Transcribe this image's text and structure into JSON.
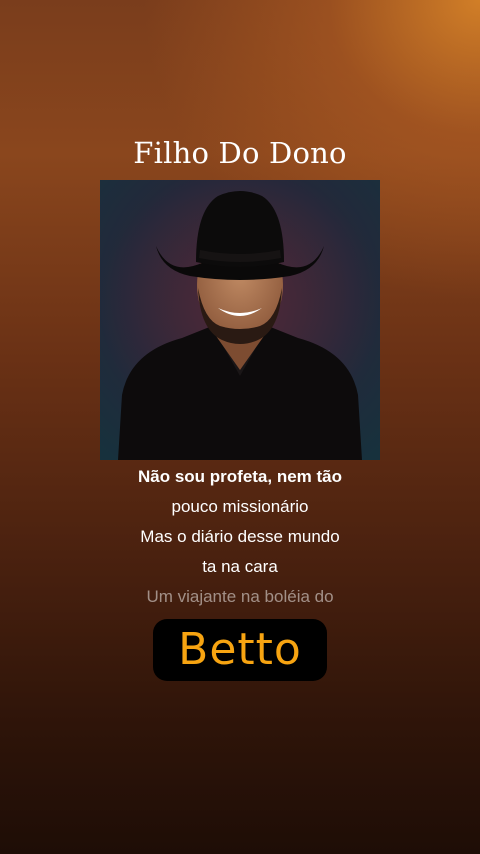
{
  "song": {
    "title": "Filho Do Dono"
  },
  "lyrics": {
    "lines": [
      "Não sou profeta, nem tão",
      "pouco missionário",
      "Mas o diário desse mundo",
      "ta na cara",
      "Um viajante na boléia do"
    ]
  },
  "badge": {
    "text": "Betto"
  },
  "colors": {
    "accent": "#f7a411",
    "badge_background": "#000000"
  }
}
